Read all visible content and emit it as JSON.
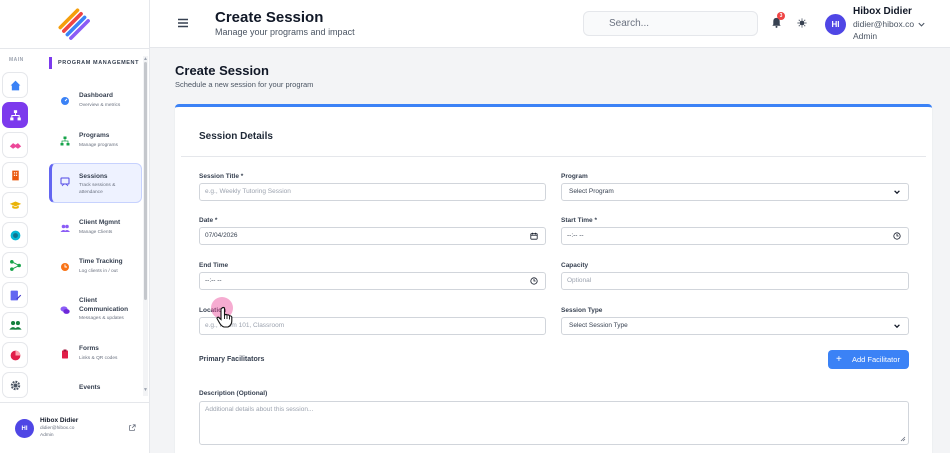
{
  "sidebar": {
    "main_label": "MAIN",
    "section_title": "PROGRAM MANAGEMENT",
    "items": [
      {
        "title": "Dashboard",
        "sub": "Overview & metrics"
      },
      {
        "title": "Programs",
        "sub": "Manage programs"
      },
      {
        "title": "Sessions",
        "sub": "Track sessions & attendance"
      },
      {
        "title": "Client Mgmnt",
        "sub": "Manage Clients"
      },
      {
        "title": "Time Tracking",
        "sub": "Log clients in / out"
      },
      {
        "title": "Client Communication",
        "sub": "Messages & updates"
      },
      {
        "title": "Forms",
        "sub": "Links & QR codes"
      },
      {
        "title": "Events",
        "sub": ""
      }
    ],
    "user": {
      "initials": "HI",
      "name": "Hibox Didier",
      "email": "didier@hibox.co",
      "role": "Admin"
    }
  },
  "header": {
    "title": "Create Session",
    "subtitle": "Manage your programs and impact",
    "search_placeholder": "Search...",
    "notification_count": "3",
    "user": {
      "initials": "HI",
      "name": "Hibox Didier",
      "email": "didier@hibox.co",
      "role": "Admin"
    }
  },
  "page": {
    "title": "Create Session",
    "subtitle": "Schedule a new session for your program"
  },
  "form": {
    "card_title": "Session Details",
    "session_title_label": "Session Title *",
    "session_title_placeholder": "e.g., Weekly Tutoring Session",
    "program_label": "Program",
    "program_value": "Select Program",
    "date_label": "Date *",
    "date_value": "07/04/2026",
    "start_time_label": "Start Time *",
    "start_time_value": "--:-- --",
    "end_time_label": "End Time",
    "end_time_value": "--:-- --",
    "capacity_label": "Capacity",
    "capacity_placeholder": "Optional",
    "location_label": "Location",
    "location_placeholder": "e.g., Room 101, Classroom",
    "session_type_label": "Session Type",
    "session_type_value": "Select Session Type",
    "facilitators_label": "Primary Facilitators",
    "add_facilitator_label": "Add Facilitator",
    "description_label": "Description (Optional)",
    "description_placeholder": "Additional details about this session..."
  },
  "colors": {
    "accent": "#3b82f6",
    "brand": "#7c3aed",
    "avatar": "#4f46e5"
  }
}
